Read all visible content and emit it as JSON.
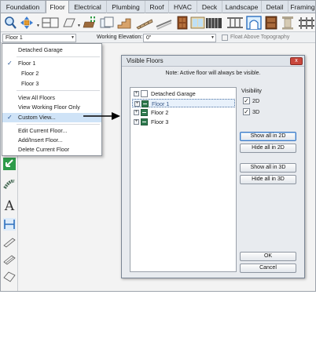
{
  "ribbon": {
    "tabs": [
      "Foundation",
      "Floor",
      "Electrical",
      "Plumbing",
      "Roof",
      "HVAC",
      "Deck",
      "Landscape",
      "Detail",
      "Framing"
    ],
    "active_tab": "Floor"
  },
  "toolbar": {
    "icons": [
      "magnifier-icon",
      "move-tool-icon",
      "floor-plan-icon",
      "add-floor-icon",
      "stairs-icon",
      "ramp-icon",
      "railing-icon",
      "column-icon",
      "cabinet-icon",
      "window-icon",
      "door-icon"
    ]
  },
  "option_bar": {
    "floor_select_value": "Floor 1",
    "working_elevation_label": "Working Elevation:",
    "working_elevation_value": "0\"",
    "float_label": "Float Above Topography"
  },
  "floor_menu": {
    "items": [
      {
        "label": "Detached Garage",
        "checked": false,
        "sub": false
      },
      {
        "label": "Floor 1",
        "checked": true,
        "sub": false
      },
      {
        "label": "Floor 2",
        "checked": false,
        "sub": true
      },
      {
        "label": "Floor 3",
        "checked": false,
        "sub": true
      },
      {
        "label": "View All Floors",
        "checked": false,
        "sub": false
      },
      {
        "label": "View Working Floor Only",
        "checked": false,
        "sub": false
      },
      {
        "label": "Custom View...",
        "checked": true,
        "sub": false
      },
      {
        "label": "Edit Current Floor...",
        "checked": false,
        "sub": false
      },
      {
        "label": "Add/Insert Floor...",
        "checked": false,
        "sub": false
      },
      {
        "label": "Delete Current Floor",
        "checked": false,
        "sub": false
      }
    ]
  },
  "dialog": {
    "title": "Visible Floors",
    "close_label": "x",
    "note": "Note: Active floor will always be visible.",
    "floors": [
      {
        "label": "Detached Garage",
        "visible": false
      },
      {
        "label": "Floor 1",
        "visible": true
      },
      {
        "label": "Floor 2",
        "visible": true
      },
      {
        "label": "Floor 3",
        "visible": true
      }
    ],
    "visibility": {
      "heading": "Visibility",
      "opt_2d": "2D",
      "opt_3d": "3D",
      "checked_2d": true,
      "checked_3d": true
    },
    "buttons": {
      "show_all_2d": "Show all in 2D",
      "hide_all_2d": "Hide all in 2D",
      "show_all_3d": "Show all in 3D",
      "hide_all_3d": "Hide all in 3D",
      "ok": "OK",
      "cancel": "Cancel"
    }
  },
  "colors": {
    "accent_blue": "#3d79c4",
    "floor_green": "#2f7a4e",
    "highlight": "#cfe3f7",
    "close_red": "#c9473c"
  }
}
